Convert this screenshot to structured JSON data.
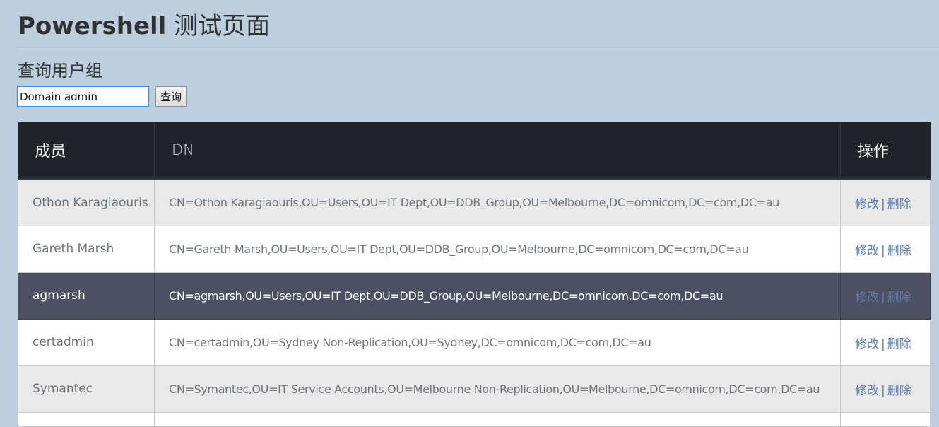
{
  "page": {
    "title_latin": "Powershell",
    "title_cjk": "测试页面"
  },
  "query": {
    "heading": "查询用户组",
    "input_value": "Domain admin",
    "button_label": "查询"
  },
  "table": {
    "headers": {
      "member": "成员",
      "dn": "DN",
      "action": "操作"
    },
    "rows": [
      {
        "member": "Othon Karagiaouris",
        "dn": "CN=Othon Karagiaouris,OU=Users,OU=IT Dept,OU=DDB_Group,OU=Melbourne,DC=omnicom,DC=com,DC=au",
        "edit_label": "修改",
        "separator": "|",
        "delete_label": "删除"
      },
      {
        "member": "Gareth Marsh",
        "dn": "CN=Gareth Marsh,OU=Users,OU=IT Dept,OU=DDB_Group,OU=Melbourne,DC=omnicom,DC=com,DC=au",
        "edit_label": "修改",
        "separator": "|",
        "delete_label": "删除"
      },
      {
        "member": "agmarsh",
        "dn": "CN=agmarsh,OU=Users,OU=IT Dept,OU=DDB_Group,OU=Melbourne,DC=omnicom,DC=com,DC=au",
        "edit_label": "修改",
        "separator": "|",
        "delete_label": "删除"
      },
      {
        "member": "certadmin",
        "dn": "CN=certadmin,OU=Sydney Non-Replication,OU=Sydney,DC=omnicom,DC=com,DC=au",
        "edit_label": "修改",
        "separator": "|",
        "delete_label": "删除"
      },
      {
        "member": "Symantec",
        "dn": "CN=Symantec,OU=IT Service Accounts,OU=Melbourne Non-Replication,OU=Melbourne,DC=omnicom,DC=com,DC=au",
        "edit_label": "修改",
        "separator": "|",
        "delete_label": "删除"
      }
    ]
  },
  "colors": {
    "page_background": "#bdcedf",
    "table_header_background": "#212529",
    "active_row_background": "#4d4f62",
    "striped_row_background": "#e9e9e9",
    "link_color": "#5a7fb8"
  }
}
